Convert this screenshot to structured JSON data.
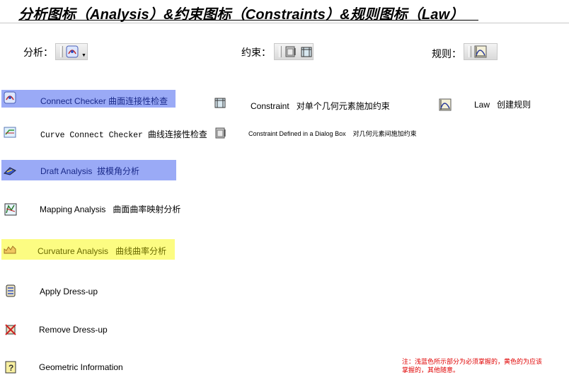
{
  "header": {
    "title": "分析图标（Analysis）&约束图标（Constraints）&规则图标（Law）"
  },
  "categories": {
    "analysis_label": "分析：",
    "constraint_label": "约束：",
    "law_label": "规则："
  },
  "analysis_items": [
    {
      "en": "Connect Checker",
      "cn": "曲面连接性检查",
      "icon": "connect-checker-icon",
      "highlight": "blue"
    },
    {
      "en": "Curve Connect Checker",
      "cn": "曲线连接性检查",
      "icon": "curve-connect-checker-icon",
      "highlight": "none"
    },
    {
      "en": "Draft Analysis",
      "cn": "拔模角分析",
      "icon": "draft-analysis-icon",
      "highlight": "blue"
    },
    {
      "en": "Mapping Analysis",
      "cn": "曲面曲率映射分析",
      "icon": "mapping-analysis-icon",
      "highlight": "none"
    },
    {
      "en": "Curvature Analysis",
      "cn": "曲线曲率分析",
      "icon": "curvature-analysis-icon",
      "highlight": "yellow"
    },
    {
      "en": "Apply Dress-up",
      "cn": "",
      "icon": "apply-dressup-icon",
      "highlight": "none"
    },
    {
      "en": "Remove Dress-up",
      "cn": "",
      "icon": "remove-dressup-icon",
      "highlight": "none"
    },
    {
      "en": "Geometric Information",
      "cn": "",
      "icon": "geometric-info-icon",
      "highlight": "none"
    }
  ],
  "constraint_items": [
    {
      "en": "Constraint",
      "cn": "对单个几何元素施加约束",
      "icon": "constraint-icon"
    },
    {
      "en": "Constraint Defined in a Dialog Box",
      "cn": "对几何元素间施加约束",
      "icon": "constraint-dialog-icon"
    }
  ],
  "law_items": [
    {
      "en": "Law",
      "cn": "创建规则",
      "icon": "law-icon"
    }
  ],
  "note": {
    "text": "注：浅蓝色所示部分为必须掌握的，黄色的为应该掌握的，其他随意。"
  },
  "colors": {
    "highlight_blue": "#9aaaf6",
    "highlight_yellow": "#fcfc82",
    "note_red": "#e00000"
  }
}
